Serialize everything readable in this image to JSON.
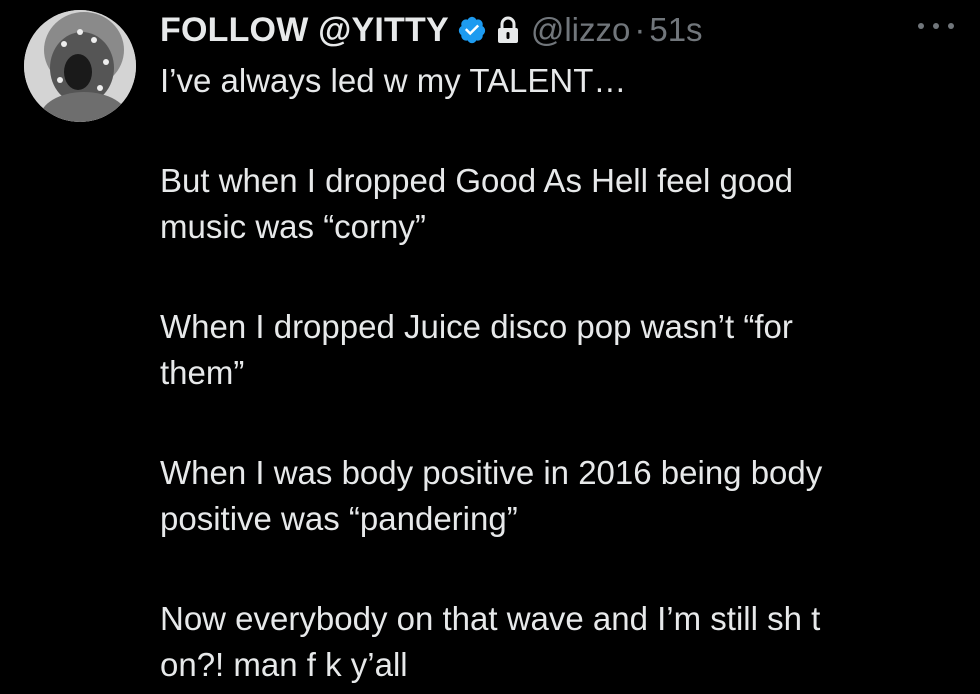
{
  "tweet": {
    "display_name": "FOLLOW @YITTY",
    "handle": "@lizzo",
    "separator": "·",
    "time": "51s",
    "verified_icon": "verified-badge-icon",
    "lock_icon": "lock-icon",
    "more_icon": "more-options-icon",
    "accent_color": "#1d9bf0",
    "lines": {
      "p1": "I’ve always led w my TALENT…",
      "p2a": "But when I dropped Good As Hell feel good",
      "p2b": "music was “corny”",
      "p3a": "When I dropped Juice disco pop wasn’t “for",
      "p3b": "them”",
      "p4a": "When I was body positive in 2016 being body",
      "p4b": "positive was “pandering”",
      "p5a": "Now everybody on that wave and I’m still sh t",
      "p5b": "on?! man f    k y’all"
    }
  }
}
